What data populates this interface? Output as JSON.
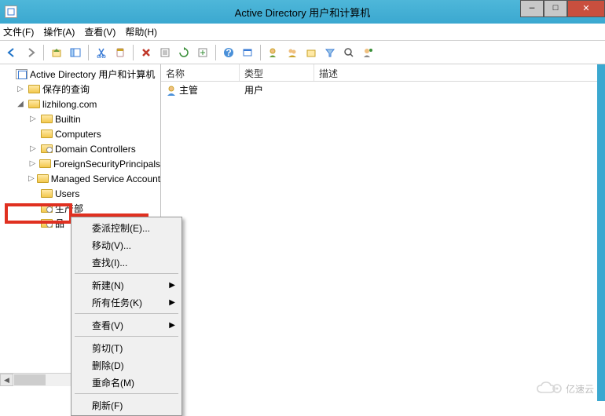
{
  "window": {
    "title": "Active Directory 用户和计算机",
    "min": "—",
    "max": "□",
    "close": "✕"
  },
  "menu": {
    "file": "文件(F)",
    "action": "操作(A)",
    "view": "查看(V)",
    "help": "帮助(H)"
  },
  "tree": {
    "root": "Active Directory 用户和计算机",
    "saved": "保存的查询",
    "domain": "lizhilong.com",
    "builtin": "Builtin",
    "computers": "Computers",
    "dc": "Domain Controllers",
    "fsp": "ForeignSecurityPrincipals",
    "msa": "Managed Service Accounts",
    "users": "Users",
    "ou1": "生产部",
    "ou2": "品"
  },
  "list": {
    "headers": {
      "name": "名称",
      "type": "类型",
      "desc": "描述"
    },
    "rows": [
      {
        "name": "主管",
        "type": "用户",
        "desc": ""
      }
    ]
  },
  "context": {
    "delegate": "委派控制(E)...",
    "move": "移动(V)...",
    "find": "查找(I)...",
    "new": "新建(N)",
    "alltasks": "所有任务(K)",
    "view": "查看(V)",
    "cut": "剪切(T)",
    "delete": "删除(D)",
    "rename": "重命名(M)",
    "refresh": "刷新(F)"
  },
  "watermark": "亿速云"
}
